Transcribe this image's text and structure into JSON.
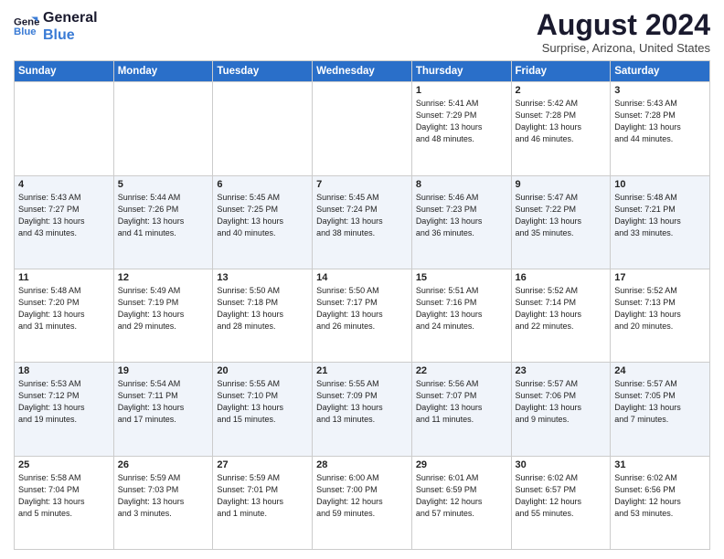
{
  "logo": {
    "line1": "General",
    "line2": "Blue"
  },
  "title": "August 2024",
  "location": "Surprise, Arizona, United States",
  "days_of_week": [
    "Sunday",
    "Monday",
    "Tuesday",
    "Wednesday",
    "Thursday",
    "Friday",
    "Saturday"
  ],
  "weeks": [
    [
      {
        "day": "",
        "info": ""
      },
      {
        "day": "",
        "info": ""
      },
      {
        "day": "",
        "info": ""
      },
      {
        "day": "",
        "info": ""
      },
      {
        "day": "1",
        "info": "Sunrise: 5:41 AM\nSunset: 7:29 PM\nDaylight: 13 hours\nand 48 minutes."
      },
      {
        "day": "2",
        "info": "Sunrise: 5:42 AM\nSunset: 7:28 PM\nDaylight: 13 hours\nand 46 minutes."
      },
      {
        "day": "3",
        "info": "Sunrise: 5:43 AM\nSunset: 7:28 PM\nDaylight: 13 hours\nand 44 minutes."
      }
    ],
    [
      {
        "day": "4",
        "info": "Sunrise: 5:43 AM\nSunset: 7:27 PM\nDaylight: 13 hours\nand 43 minutes."
      },
      {
        "day": "5",
        "info": "Sunrise: 5:44 AM\nSunset: 7:26 PM\nDaylight: 13 hours\nand 41 minutes."
      },
      {
        "day": "6",
        "info": "Sunrise: 5:45 AM\nSunset: 7:25 PM\nDaylight: 13 hours\nand 40 minutes."
      },
      {
        "day": "7",
        "info": "Sunrise: 5:45 AM\nSunset: 7:24 PM\nDaylight: 13 hours\nand 38 minutes."
      },
      {
        "day": "8",
        "info": "Sunrise: 5:46 AM\nSunset: 7:23 PM\nDaylight: 13 hours\nand 36 minutes."
      },
      {
        "day": "9",
        "info": "Sunrise: 5:47 AM\nSunset: 7:22 PM\nDaylight: 13 hours\nand 35 minutes."
      },
      {
        "day": "10",
        "info": "Sunrise: 5:48 AM\nSunset: 7:21 PM\nDaylight: 13 hours\nand 33 minutes."
      }
    ],
    [
      {
        "day": "11",
        "info": "Sunrise: 5:48 AM\nSunset: 7:20 PM\nDaylight: 13 hours\nand 31 minutes."
      },
      {
        "day": "12",
        "info": "Sunrise: 5:49 AM\nSunset: 7:19 PM\nDaylight: 13 hours\nand 29 minutes."
      },
      {
        "day": "13",
        "info": "Sunrise: 5:50 AM\nSunset: 7:18 PM\nDaylight: 13 hours\nand 28 minutes."
      },
      {
        "day": "14",
        "info": "Sunrise: 5:50 AM\nSunset: 7:17 PM\nDaylight: 13 hours\nand 26 minutes."
      },
      {
        "day": "15",
        "info": "Sunrise: 5:51 AM\nSunset: 7:16 PM\nDaylight: 13 hours\nand 24 minutes."
      },
      {
        "day": "16",
        "info": "Sunrise: 5:52 AM\nSunset: 7:14 PM\nDaylight: 13 hours\nand 22 minutes."
      },
      {
        "day": "17",
        "info": "Sunrise: 5:52 AM\nSunset: 7:13 PM\nDaylight: 13 hours\nand 20 minutes."
      }
    ],
    [
      {
        "day": "18",
        "info": "Sunrise: 5:53 AM\nSunset: 7:12 PM\nDaylight: 13 hours\nand 19 minutes."
      },
      {
        "day": "19",
        "info": "Sunrise: 5:54 AM\nSunset: 7:11 PM\nDaylight: 13 hours\nand 17 minutes."
      },
      {
        "day": "20",
        "info": "Sunrise: 5:55 AM\nSunset: 7:10 PM\nDaylight: 13 hours\nand 15 minutes."
      },
      {
        "day": "21",
        "info": "Sunrise: 5:55 AM\nSunset: 7:09 PM\nDaylight: 13 hours\nand 13 minutes."
      },
      {
        "day": "22",
        "info": "Sunrise: 5:56 AM\nSunset: 7:07 PM\nDaylight: 13 hours\nand 11 minutes."
      },
      {
        "day": "23",
        "info": "Sunrise: 5:57 AM\nSunset: 7:06 PM\nDaylight: 13 hours\nand 9 minutes."
      },
      {
        "day": "24",
        "info": "Sunrise: 5:57 AM\nSunset: 7:05 PM\nDaylight: 13 hours\nand 7 minutes."
      }
    ],
    [
      {
        "day": "25",
        "info": "Sunrise: 5:58 AM\nSunset: 7:04 PM\nDaylight: 13 hours\nand 5 minutes."
      },
      {
        "day": "26",
        "info": "Sunrise: 5:59 AM\nSunset: 7:03 PM\nDaylight: 13 hours\nand 3 minutes."
      },
      {
        "day": "27",
        "info": "Sunrise: 5:59 AM\nSunset: 7:01 PM\nDaylight: 13 hours\nand 1 minute."
      },
      {
        "day": "28",
        "info": "Sunrise: 6:00 AM\nSunset: 7:00 PM\nDaylight: 12 hours\nand 59 minutes."
      },
      {
        "day": "29",
        "info": "Sunrise: 6:01 AM\nSunset: 6:59 PM\nDaylight: 12 hours\nand 57 minutes."
      },
      {
        "day": "30",
        "info": "Sunrise: 6:02 AM\nSunset: 6:57 PM\nDaylight: 12 hours\nand 55 minutes."
      },
      {
        "day": "31",
        "info": "Sunrise: 6:02 AM\nSunset: 6:56 PM\nDaylight: 12 hours\nand 53 minutes."
      }
    ]
  ]
}
